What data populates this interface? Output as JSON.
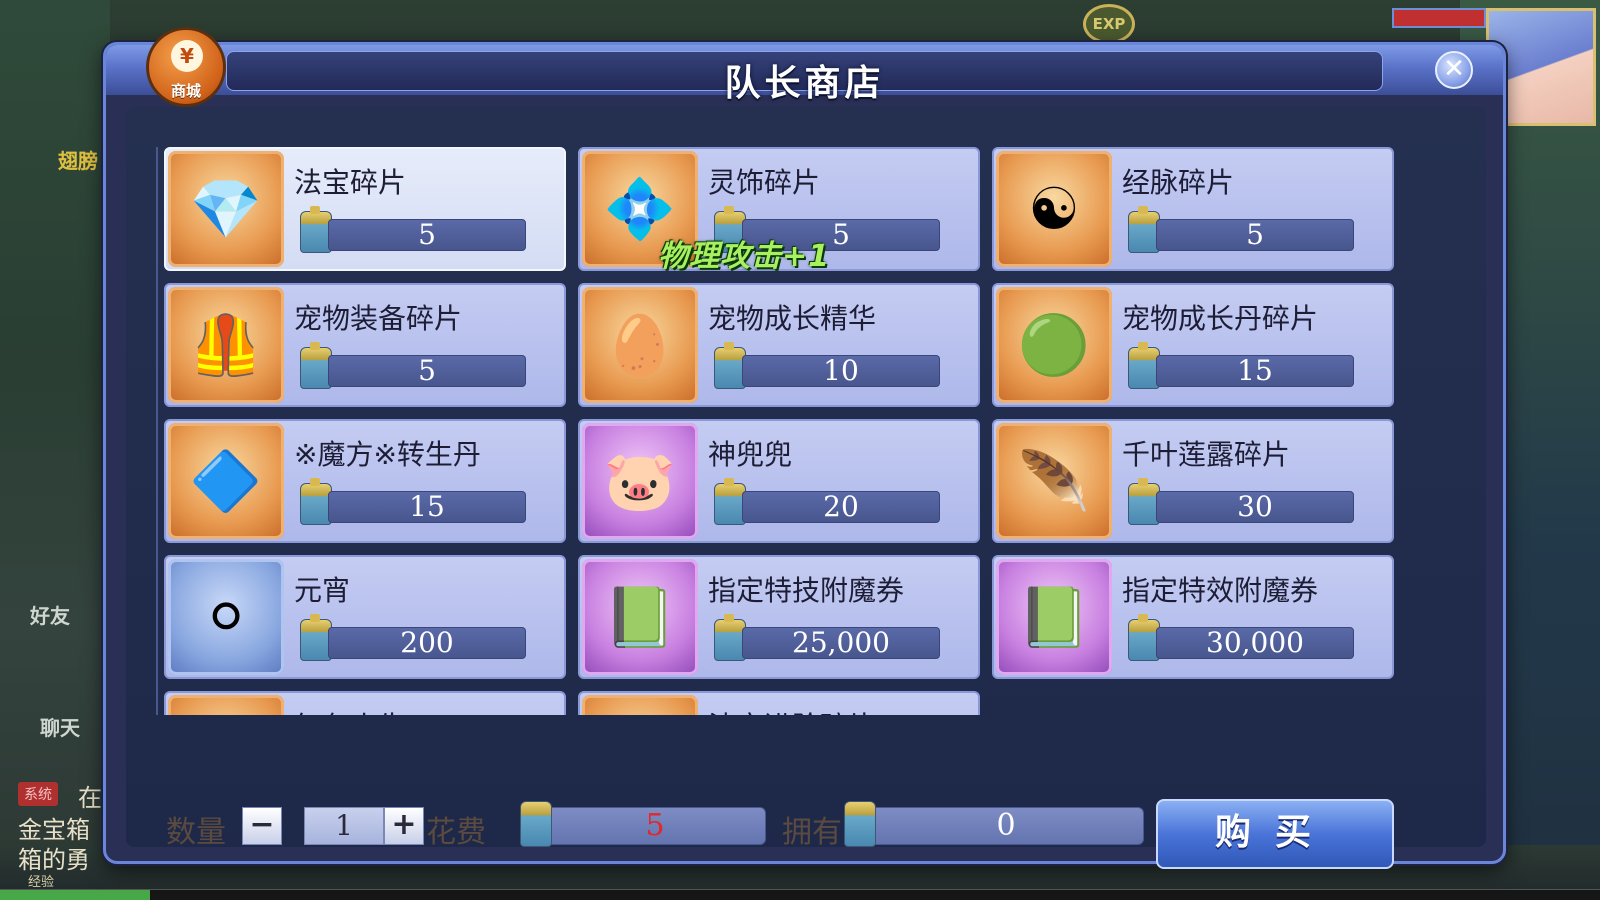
{
  "hud": {
    "exp_badge": "EXP",
    "friend_label": "好友",
    "chat_label": "聊天",
    "side_label_top": "翅膀",
    "system_tag": "系统",
    "chat_line1": "在",
    "chat_line2": "金宝箱",
    "chat_line3": "箱的勇",
    "exp_label": "经验",
    "exp_progress": 0.094
  },
  "modal": {
    "title": "队长商店",
    "shop_badge_symbol": "¥",
    "shop_badge_label": "商城",
    "close_symbol": "✕"
  },
  "floating_text": "物理攻击+1",
  "items": [
    {
      "name": "法宝碎片",
      "price": "5",
      "icon": "rainbow-gems",
      "icon_glyph": "💎",
      "frame": "orange"
    },
    {
      "name": "灵饰碎片",
      "price": "5",
      "icon": "green-gems",
      "icon_glyph": "💠",
      "frame": "orange"
    },
    {
      "name": "经脉碎片",
      "price": "5",
      "icon": "yin-yang",
      "icon_glyph": "☯",
      "frame": "orange"
    },
    {
      "name": "宠物装备碎片",
      "price": "5",
      "icon": "pet-armor",
      "icon_glyph": "🦺",
      "frame": "orange"
    },
    {
      "name": "宠物成长精华",
      "price": "10",
      "icon": "spiral-egg",
      "icon_glyph": "🥚",
      "frame": "orange"
    },
    {
      "name": "宠物成长丹碎片",
      "price": "15",
      "icon": "jewel-box",
      "icon_glyph": "🟢",
      "frame": "orange"
    },
    {
      "name": "※魔方※转生丹",
      "price": "15",
      "icon": "crystal",
      "icon_glyph": "🔷",
      "frame": "orange"
    },
    {
      "name": "神兜兜",
      "price": "20",
      "icon": "lucky-bag-pet",
      "icon_glyph": "🐷",
      "frame": "purple"
    },
    {
      "name": "千叶莲露碎片",
      "price": "30",
      "icon": "phoenix-feather",
      "icon_glyph": "🪶",
      "frame": "orange"
    },
    {
      "name": "元宵",
      "price": "200",
      "icon": "rice-ball",
      "icon_glyph": "⚪",
      "frame": "blue"
    },
    {
      "name": "指定特技附魔券",
      "price": "25,000",
      "icon": "enchant-book",
      "icon_glyph": "📗",
      "frame": "purple"
    },
    {
      "name": "指定特效附魔券",
      "price": "30,000",
      "icon": "enchant-book",
      "icon_glyph": "📗",
      "frame": "purple"
    },
    {
      "name": "红色小生",
      "price": "",
      "icon": "partial-item",
      "icon_glyph": "",
      "frame": "orange"
    },
    {
      "name": "法宝进阶碎片",
      "price": "",
      "icon": "partial-item",
      "icon_glyph": "",
      "frame": "orange"
    }
  ],
  "footer": {
    "quantity_label": "数量",
    "quantity_value": "1",
    "minus_label": "−",
    "plus_label": "+",
    "cost_label": "花费",
    "cost_value": "5",
    "owned_label": "拥有",
    "owned_value": "0",
    "buy_label": "购买"
  },
  "colors": {
    "card_bg": "#aeb8ea",
    "selected_card_bg": "#d4dcf4",
    "cost_text": "#e02828",
    "floating_text": "#a8f060",
    "buy_button": "#4a74d8"
  }
}
